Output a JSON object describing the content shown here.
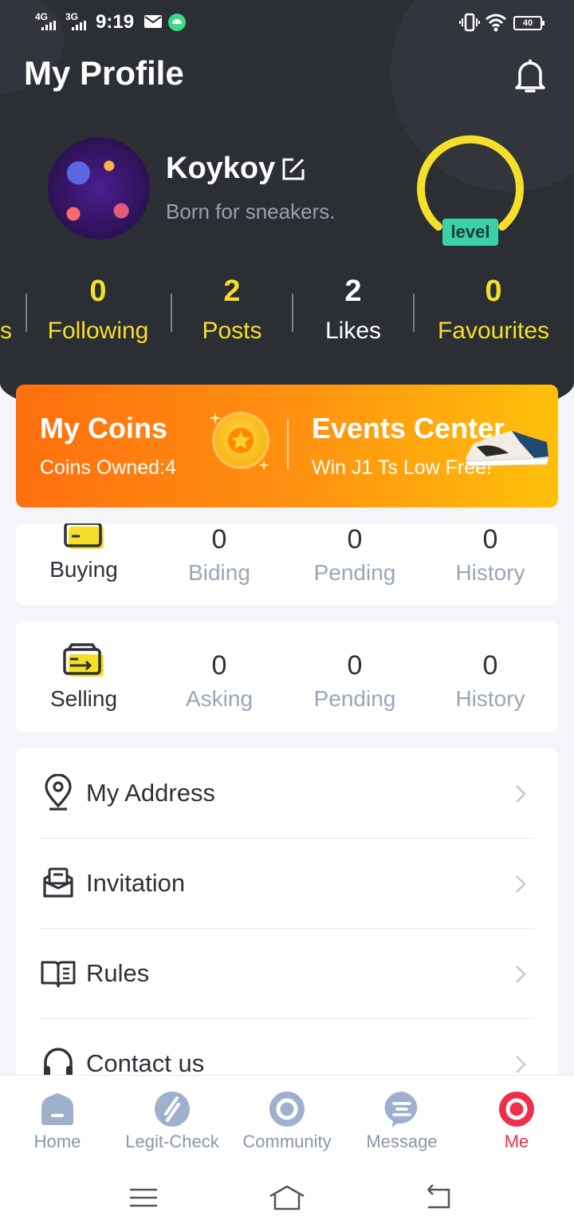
{
  "status_bar": {
    "time": "9:19",
    "net1": "4G",
    "net2": "3G",
    "battery": "40"
  },
  "header": {
    "title": "My Profile"
  },
  "profile": {
    "username": "Koykoy",
    "bio": "Born for sneakers.",
    "level_label": "level"
  },
  "stats": [
    {
      "value": "0",
      "label": "Following"
    },
    {
      "value": "2",
      "label": "Posts"
    },
    {
      "value": "2",
      "label": "Likes"
    },
    {
      "value": "0",
      "label": "Favourites"
    }
  ],
  "stats_partial_label": "s",
  "promo": {
    "coins_title": "My Coins",
    "coins_sub": "Coins Owned:4",
    "events_title": "Events Center",
    "events_sub": "Win J1 Ts Low Free!"
  },
  "buying": {
    "label": "Buying",
    "items": [
      {
        "value": "0",
        "label": "Biding"
      },
      {
        "value": "0",
        "label": "Pending"
      },
      {
        "value": "0",
        "label": "History"
      }
    ]
  },
  "selling": {
    "label": "Selling",
    "items": [
      {
        "value": "0",
        "label": "Asking"
      },
      {
        "value": "0",
        "label": "Pending"
      },
      {
        "value": "0",
        "label": "History"
      }
    ]
  },
  "menu": [
    {
      "label": "My Address",
      "icon": "location-pin-icon"
    },
    {
      "label": "Invitation",
      "icon": "invitation-icon"
    },
    {
      "label": "Rules",
      "icon": "book-icon"
    },
    {
      "label": "Contact us",
      "icon": "headset-icon"
    }
  ],
  "tabs": [
    {
      "label": "Home",
      "icon": "home-icon"
    },
    {
      "label": "Legit-Check",
      "icon": "legit-check-icon"
    },
    {
      "label": "Community",
      "icon": "community-icon"
    },
    {
      "label": "Message",
      "icon": "message-icon"
    },
    {
      "label": "Me",
      "icon": "me-icon",
      "active": true
    }
  ],
  "colors": {
    "header_bg": "#2b2e33",
    "accent_yellow": "#f6df2a",
    "active_red": "#ee2f4a",
    "level_green": "#3ccfa8"
  }
}
